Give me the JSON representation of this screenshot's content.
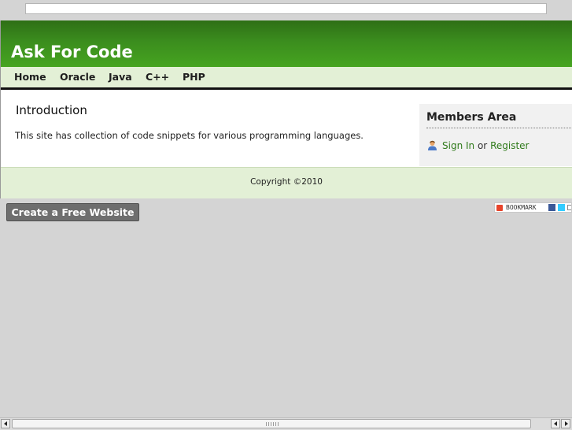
{
  "site": {
    "title": "Ask For Code",
    "nav": [
      "Home",
      "Oracle",
      "Java",
      "C++",
      "PHP"
    ]
  },
  "intro": {
    "title": "Introduction",
    "text": "This site has collection of code snippets for various programming languages."
  },
  "members": {
    "title": "Members Area",
    "sign_in": "Sign In",
    "or": "or",
    "register": "Register",
    "icon": "user-icon"
  },
  "footer": {
    "copyright": "Copyright ©2010"
  },
  "create_button": "Create a Free Website",
  "bookmark": {
    "label": "BOOKMARK"
  },
  "colors": {
    "header_green": "#46a420",
    "nav_bg": "#e3f0d6",
    "link_green": "#2f7a1a"
  }
}
